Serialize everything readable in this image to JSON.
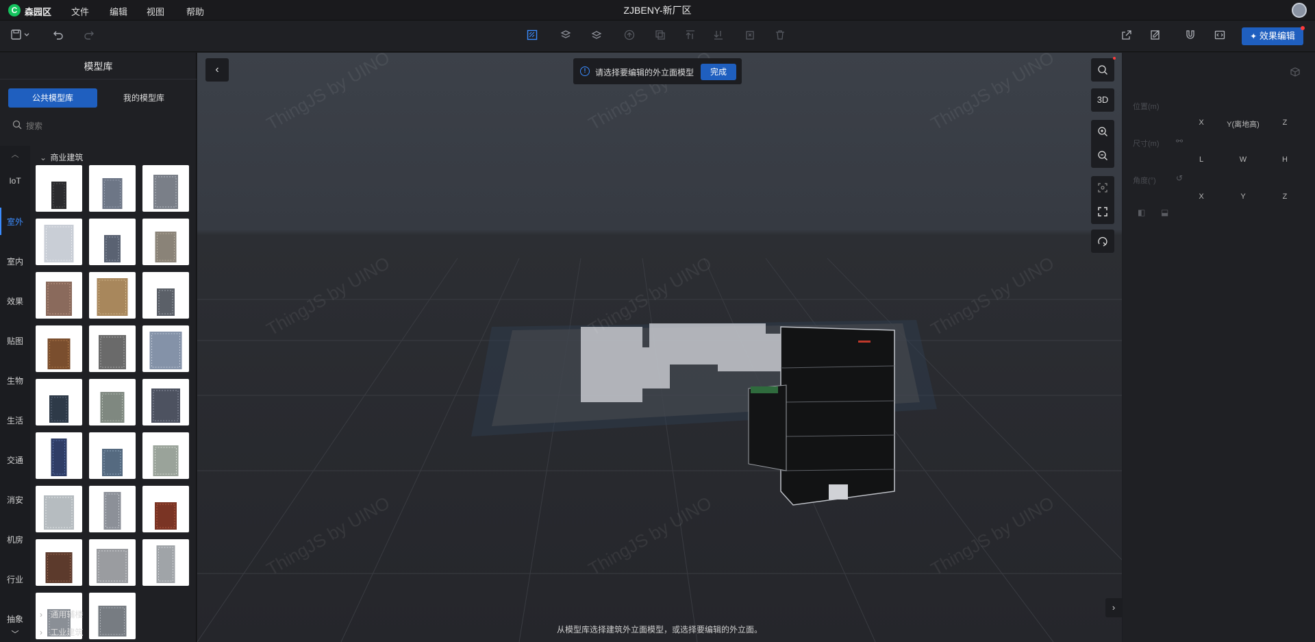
{
  "app": {
    "name": "森园区",
    "title": "ZJBENY-新厂区"
  },
  "menu": [
    "文件",
    "编辑",
    "视图",
    "帮助"
  ],
  "toolbar": {
    "effect_label": "效果编辑"
  },
  "library": {
    "title": "模型库",
    "tabs": [
      "公共模型库",
      "我的模型库"
    ],
    "search_placeholder": "搜索",
    "categories": [
      "IoT",
      "室外",
      "室内",
      "效果",
      "贴图",
      "生物",
      "生活",
      "交通",
      "消安",
      "机房",
      "行业",
      "抽象"
    ],
    "active_category": "室外",
    "groups": [
      {
        "label": "商业建筑",
        "expanded": true,
        "count": 26
      },
      {
        "label": "通用辅楼",
        "expanded": false
      },
      {
        "label": "工业建筑",
        "expanded": false
      }
    ]
  },
  "viewport": {
    "hint": "请选择要编辑的外立面模型",
    "done_label": "完成",
    "view_mode": "3D",
    "bottom_hint": "从模型库选择建筑外立面模型，或选择要编辑的外立面。",
    "watermark": "ThingJS by UINO"
  },
  "properties": {
    "position_label": "位置(m)",
    "size_label": "尺寸(m)",
    "angle_label": "角度(°)",
    "position_axes": [
      "X",
      "Y(离地高)",
      "Z"
    ],
    "size_axes": [
      "L",
      "W",
      "H"
    ],
    "angle_axes": [
      "X",
      "Y",
      "Z"
    ]
  },
  "colors": {
    "accent": "#1f5fbf",
    "active_text": "#3b8cff",
    "logo": "#14c45e"
  }
}
